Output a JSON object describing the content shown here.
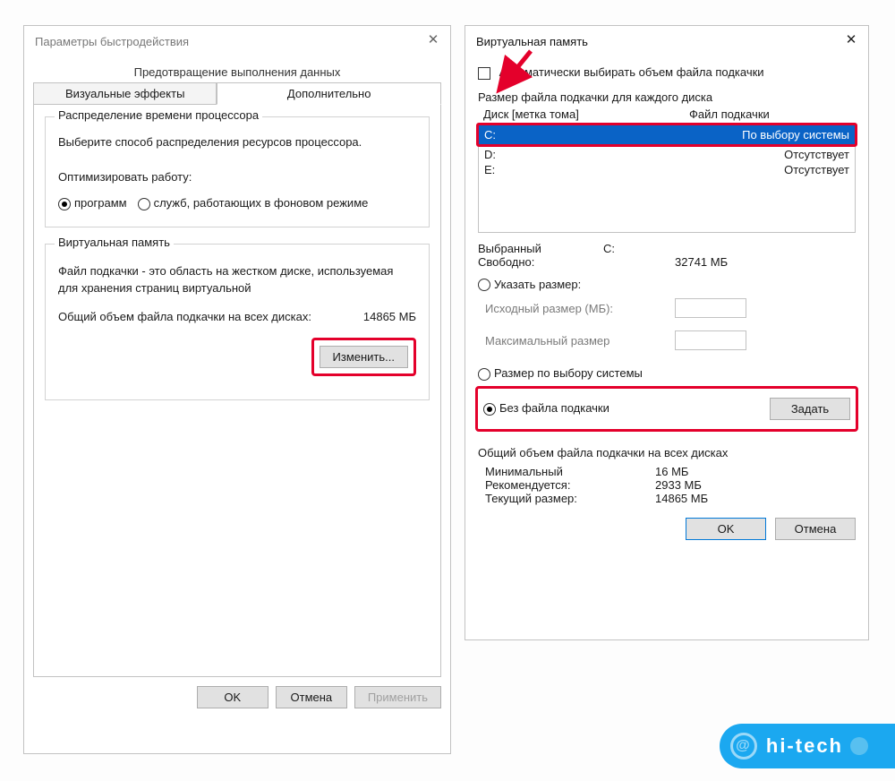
{
  "dialog1": {
    "title": "Параметры быстродействия",
    "tab_top": "Предотвращение выполнения данных",
    "tab_visual": "Визуальные эффекты",
    "tab_advanced": "Дополнительно",
    "group_cpu_title": "Распределение времени процессора",
    "cpu_instr": "Выберите способ распределения ресурсов процессора.",
    "optimize_label": "Оптимизировать работу:",
    "radio_programs": "программ",
    "radio_services": "служб, работающих в фоновом режиме",
    "group_vm_title": "Виртуальная память",
    "vm_descr": "Файл подкачки - это область на жестком диске, используемая для хранения страниц виртуальной",
    "vm_total_label": "Общий объем файла подкачки на всех дисках:",
    "vm_total_value": "14865 МБ",
    "change_btn": "Изменить...",
    "ok": "OK",
    "cancel": "Отмена",
    "apply": "Применить"
  },
  "dialog2": {
    "title": "Виртуальная память",
    "auto_check": "Автоматически выбирать объем файла подкачки",
    "size_per_disk": "Размер файла подкачки для каждого диска",
    "col_disk": "Диск [метка тома]",
    "col_file": "Файл подкачки",
    "rows": [
      {
        "drive": "C:",
        "status": "По выбору системы",
        "selected": true
      },
      {
        "drive": "D:",
        "status": "Отсутствует",
        "selected": false
      },
      {
        "drive": "E:",
        "status": "Отсутствует",
        "selected": false
      }
    ],
    "selected_label": "Выбранный",
    "selected_value": "C:",
    "free_label": "Свободно:",
    "free_value": "32741 МБ",
    "radio_custom": "Указать размер:",
    "initial_label": "Исходный размер (МБ):",
    "max_label": "Максимальный размер",
    "radio_system": "Размер по выбору системы",
    "radio_none": "Без файла подкачки",
    "set_btn": "Задать",
    "totals_title": "Общий объем файла подкачки на всех дисках",
    "min_label": "Минимальный",
    "min_value": "16 МБ",
    "rec_label": "Рекомендуется:",
    "rec_value": "2933 МБ",
    "cur_label": "Текущий размер:",
    "cur_value": "14865 МБ",
    "ok": "OK",
    "cancel": "Отмена"
  },
  "watermark": "hi-tech"
}
